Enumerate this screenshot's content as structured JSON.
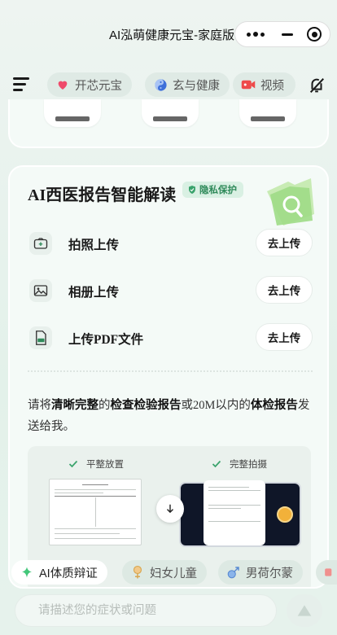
{
  "window": {
    "title": "AI泓萌健康元宝-家庭版"
  },
  "nav": {
    "pills": [
      {
        "label": "开芯元宝",
        "icon": "heart-icon"
      },
      {
        "label": "玄与健康",
        "icon": "yin-yang-icon"
      },
      {
        "label": "视频",
        "icon": "video-icon"
      }
    ]
  },
  "card": {
    "title": "AI西医报告智能解读",
    "badge": "隐私保护",
    "rows": [
      {
        "label": "拍照上传",
        "button": "去上传",
        "icon": "camera-icon"
      },
      {
        "label": "相册上传",
        "button": "去上传",
        "icon": "image-icon"
      },
      {
        "label": "上传PDF文件",
        "button": "去上传",
        "icon": "pdf-icon"
      }
    ],
    "desc": {
      "p1": "请将",
      "b1": "清晰完整",
      "p2": "的",
      "b2": "检查检验报告",
      "p3": "或20M以内的",
      "b3": "体检报告",
      "p4": "发送给我。"
    },
    "examples": {
      "left_label": "平整放置",
      "right_label": "完整拍摄"
    }
  },
  "chips": [
    {
      "label": "AI体质辩证",
      "active": true,
      "icon": "sparkle-icon"
    },
    {
      "label": "妇女儿童",
      "active": false,
      "icon": "female-icon"
    },
    {
      "label": "男荷尔蒙",
      "active": false,
      "icon": "male-icon"
    }
  ],
  "input": {
    "placeholder": "请描述您的症状或问题"
  },
  "colors": {
    "accent_green": "#2f8a5a",
    "background": "#e3f1ea",
    "card": "#f4faf7"
  }
}
